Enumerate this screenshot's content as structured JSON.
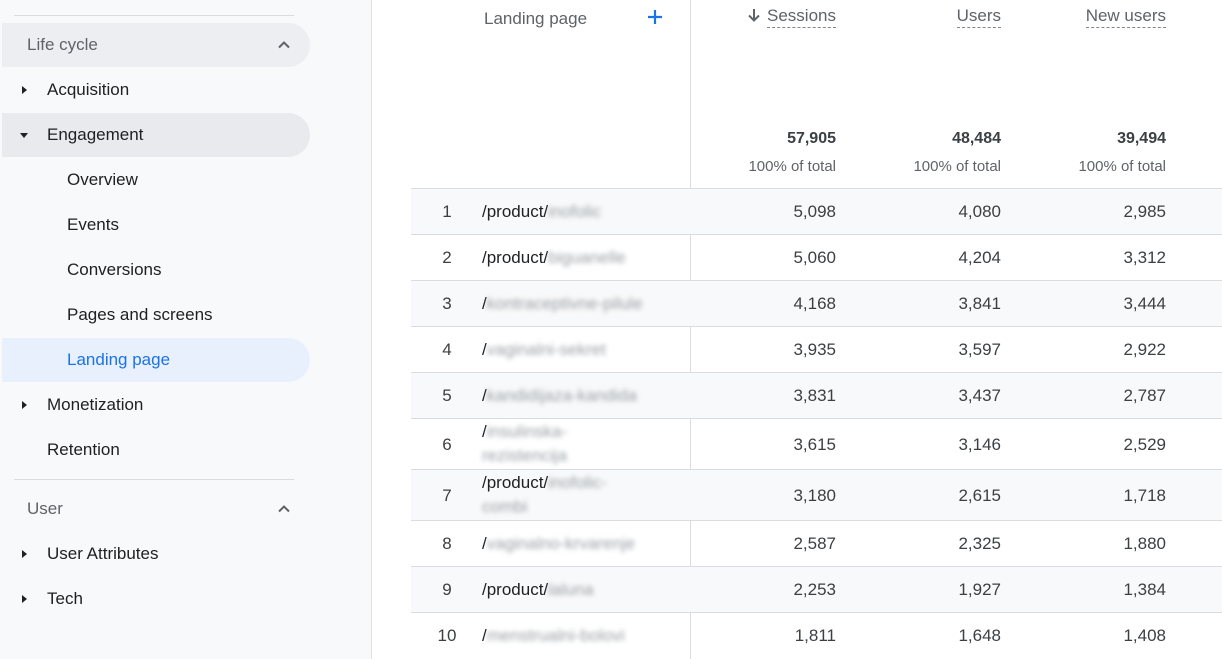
{
  "sidebar": {
    "lifecycle_header": "Life cycle",
    "items": [
      {
        "label": "Acquisition"
      },
      {
        "label": "Engagement"
      },
      {
        "label": "Overview"
      },
      {
        "label": "Events"
      },
      {
        "label": "Conversions"
      },
      {
        "label": "Pages and screens"
      },
      {
        "label": "Landing page"
      },
      {
        "label": "Monetization"
      },
      {
        "label": "Retention"
      }
    ],
    "user_header": "User",
    "user_items": [
      {
        "label": "User Attributes"
      },
      {
        "label": "Tech"
      }
    ]
  },
  "table": {
    "dimension_header": "Landing page",
    "metric_headers": {
      "sessions": "Sessions",
      "users": "Users",
      "new_users": "New users"
    },
    "sort": "sessions descending",
    "totals": {
      "sessions": "57,905",
      "users": "48,484",
      "new_users": "39,494",
      "sessions_pct": "100% of total",
      "users_pct": "100% of total",
      "new_users_pct": "100% of total"
    },
    "rows": [
      {
        "idx": "1",
        "prefix": "/product/",
        "blurred": "inofolic",
        "sessions": "5,098",
        "users": "4,080",
        "new_users": "2,985"
      },
      {
        "idx": "2",
        "prefix": "/product/",
        "blurred": "biguanelle",
        "sessions": "5,060",
        "users": "4,204",
        "new_users": "3,312"
      },
      {
        "idx": "3",
        "prefix": "/",
        "blurred": "kontraceptivne-pilule",
        "sessions": "4,168",
        "users": "3,841",
        "new_users": "3,444"
      },
      {
        "idx": "4",
        "prefix": "/",
        "blurred": "vaginalni-sekret",
        "sessions": "3,935",
        "users": "3,597",
        "new_users": "2,922"
      },
      {
        "idx": "5",
        "prefix": "/",
        "blurred": "kandidijaza-kandida",
        "sessions": "3,831",
        "users": "3,437",
        "new_users": "2,787"
      },
      {
        "idx": "6",
        "prefix": "/",
        "blurred": "insulinska-rezistencija",
        "sessions": "3,615",
        "users": "3,146",
        "new_users": "2,529"
      },
      {
        "idx": "7",
        "prefix": "/product/",
        "blurred": "inofolic-combi",
        "sessions": "3,180",
        "users": "2,615",
        "new_users": "1,718"
      },
      {
        "idx": "8",
        "prefix": "/",
        "blurred": "vaginalno-krvarenje",
        "sessions": "2,587",
        "users": "2,325",
        "new_users": "1,880"
      },
      {
        "idx": "9",
        "prefix": "/product/",
        "blurred": "laluna",
        "sessions": "2,253",
        "users": "1,927",
        "new_users": "1,384"
      },
      {
        "idx": "10",
        "prefix": "/",
        "blurred": "menstrualni-bolovi",
        "sessions": "1,811",
        "users": "1,648",
        "new_users": "1,408"
      }
    ]
  },
  "colors": {
    "accent": "#1a73e8",
    "active_bg": "#e8f0fe",
    "sidebar_bg": "#f8f9fa"
  }
}
